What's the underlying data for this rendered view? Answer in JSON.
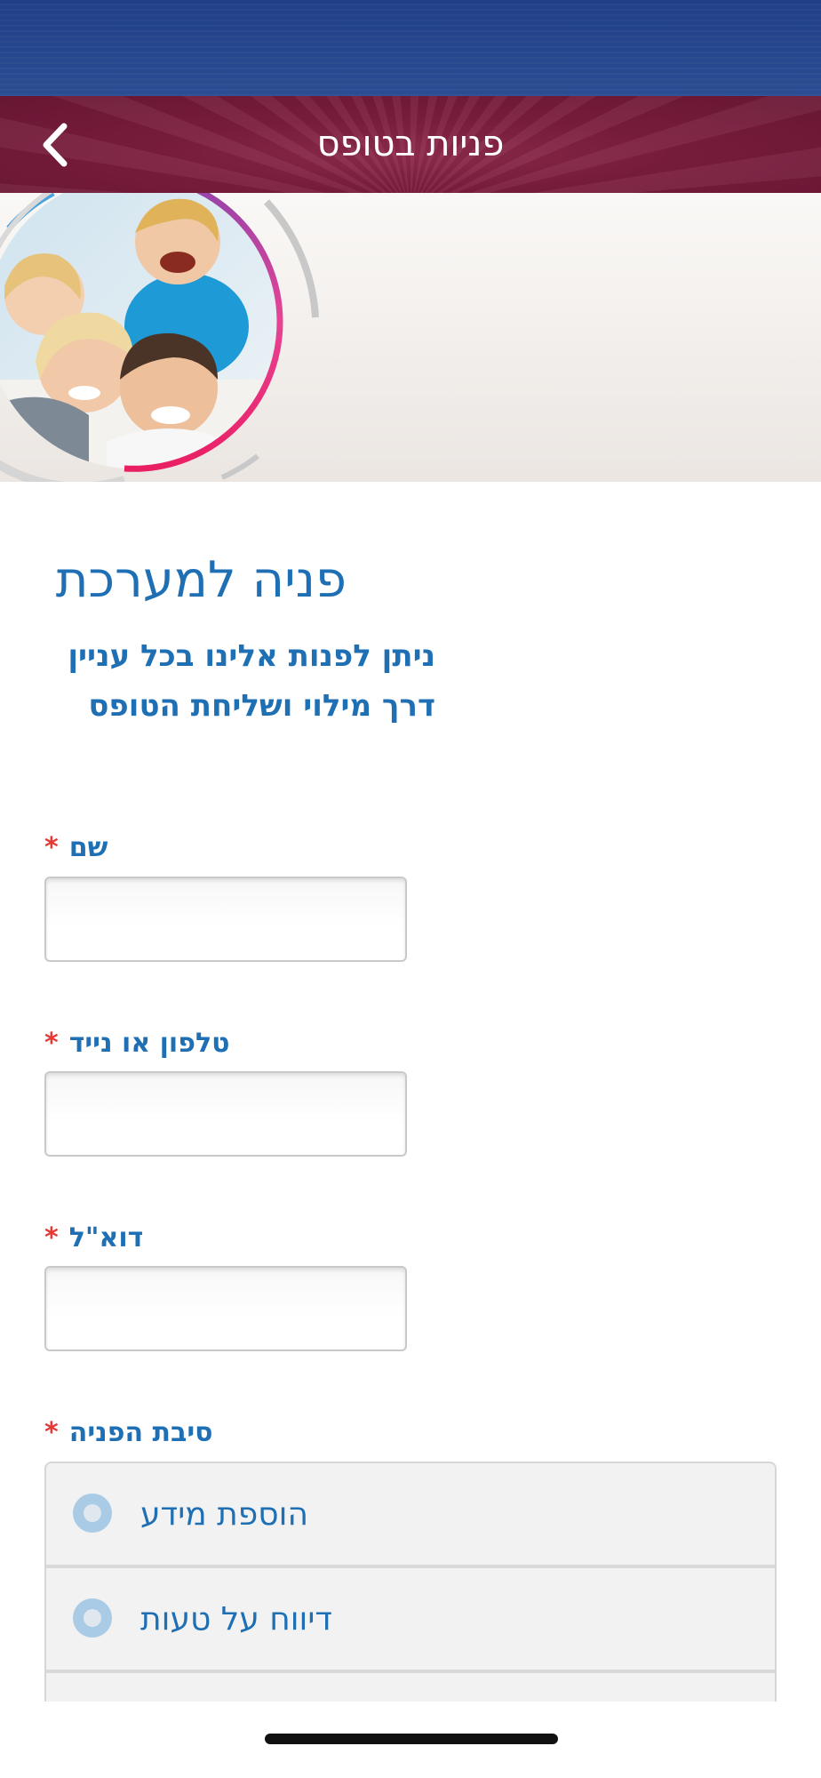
{
  "nav": {
    "title": "פניות בטופס",
    "back_icon": "chevron-left-icon"
  },
  "banner": {
    "image": "family-photo-in-circle"
  },
  "form": {
    "heading": "פניה למערכת",
    "intro_line1": "ניתן לפנות אלינו בכל עניין",
    "intro_line2": "דרך מילוי ושליחת הטופס",
    "required_mark": "*",
    "fields": [
      {
        "label": "שם",
        "value": ""
      },
      {
        "label": "טלפון או נייד",
        "value": ""
      },
      {
        "label": "דוא\"ל",
        "value": ""
      }
    ],
    "reason": {
      "label": "סיבת הפניה",
      "options": [
        {
          "label": "הוספת מידע"
        },
        {
          "label": "דיווח על טעות"
        }
      ]
    }
  },
  "colors": {
    "status_bar": "#2b4d92",
    "nav_bar": "#7a1d3d",
    "accent_text": "#1e6fb3",
    "required": "#e53935"
  }
}
